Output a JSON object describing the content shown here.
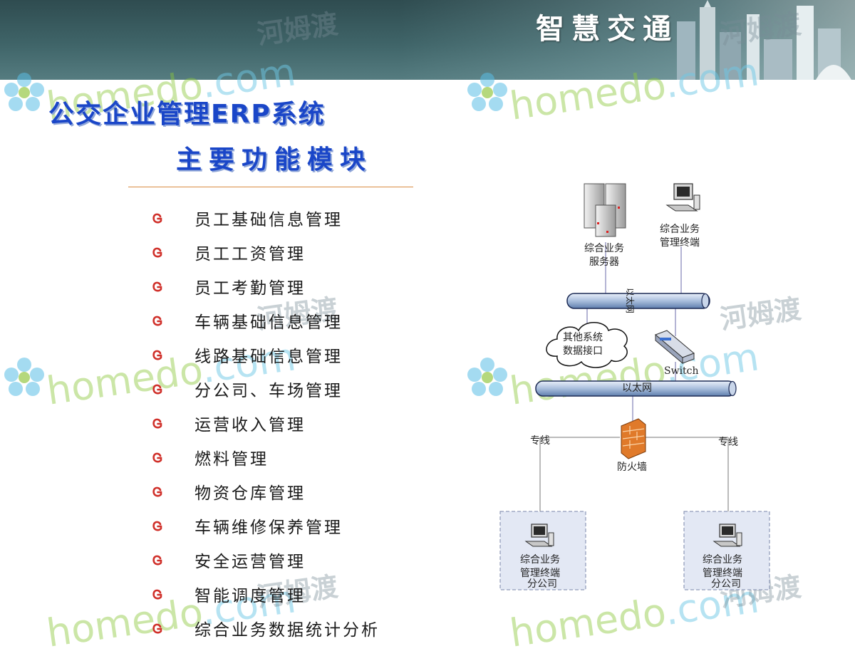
{
  "banner": {
    "title": "智慧交通"
  },
  "watermark": {
    "brand": "homedo.com",
    "brand_main": "homedo",
    "brand_suffix": ".com",
    "brand_cn": "河姆渡"
  },
  "page": {
    "title_line1": "公交企业管理ERP系统",
    "title_line2": "主要功能模块"
  },
  "modules": [
    "员工基础信息管理",
    "员工工资管理",
    "员工考勤管理",
    "车辆基础信息管理",
    "线路基础信息管理",
    "分公司、车场管理",
    "运营收入管理",
    "燃料管理",
    "物资仓库管理",
    "车辆维修保养管理",
    "安全运营管理",
    "智能调度管理",
    "综合业务数据统计分析"
  ],
  "diagram": {
    "server_label_1": "综合业务",
    "server_label_2": "服务器",
    "top_terminal_1": "综合业务",
    "top_terminal_2": "管理终端",
    "ethernet_vertical": "以太网",
    "other_sys_1": "其他系统",
    "other_sys_2": "数据接口",
    "switch": "Switch",
    "ethernet": "以太网",
    "firewall": "防火墙",
    "leased_left": "专线",
    "leased_right": "专线",
    "branch_terminal_1": "综合业务",
    "branch_terminal_2": "管理终端",
    "branch_label": "分公司"
  },
  "colors": {
    "title_blue": "#1a46c8",
    "bullet_red": "#d0302a",
    "rule_orange": "#d88a40",
    "bus_blue": "#a9bedc",
    "firewall_orange": "#e07a2a"
  }
}
